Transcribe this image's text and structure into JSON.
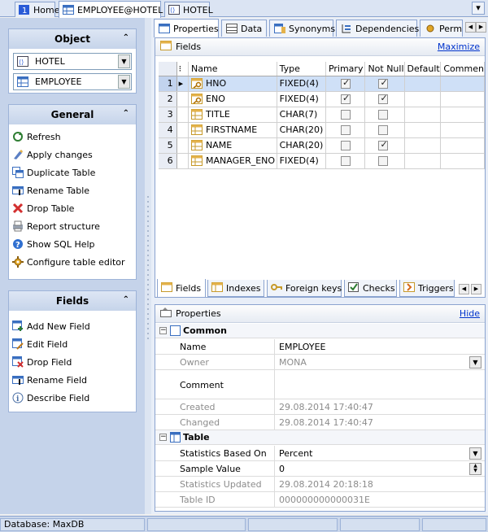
{
  "top_tabs": [
    {
      "label": "Home",
      "icon": "home-icon"
    },
    {
      "label": "EMPLOYEE@HOTEL",
      "icon": "table-icon"
    },
    {
      "label": "HOTEL",
      "icon": "database-icon"
    }
  ],
  "close_glyph": "▾",
  "left": {
    "object": {
      "title": "Object",
      "database_value": "HOTEL",
      "table_value": "EMPLOYEE"
    },
    "general": {
      "title": "General",
      "items": [
        {
          "label": "Refresh",
          "icon": "refresh-icon"
        },
        {
          "label": "Apply changes",
          "icon": "apply-icon"
        },
        {
          "label": "Duplicate Table",
          "icon": "duplicate-icon"
        },
        {
          "label": "Rename Table",
          "icon": "rename-icon"
        },
        {
          "label": "Drop Table",
          "icon": "drop-icon"
        },
        {
          "label": "Report structure",
          "icon": "report-icon"
        },
        {
          "label": "Show SQL Help",
          "icon": "help-icon"
        },
        {
          "label": "Configure table editor",
          "icon": "configure-icon"
        }
      ]
    },
    "fields": {
      "title": "Fields",
      "items": [
        {
          "label": "Add New Field",
          "icon": "add-field-icon"
        },
        {
          "label": "Edit Field",
          "icon": "edit-field-icon"
        },
        {
          "label": "Drop Field",
          "icon": "drop-field-icon"
        },
        {
          "label": "Rename Field",
          "icon": "rename-field-icon"
        },
        {
          "label": "Describe Field",
          "icon": "info-icon"
        }
      ]
    }
  },
  "right_tabs": [
    "Properties",
    "Data",
    "Synonyms",
    "Dependencies",
    "Permis"
  ],
  "fields_panel": {
    "title": "Fields",
    "maximize_label": "Maximize",
    "columns": [
      "Name",
      "Type",
      "Primary",
      "Not Null",
      "Default",
      "Commen"
    ],
    "rows": [
      {
        "num": "1",
        "name": "HNO",
        "type": "FIXED(4)",
        "primary": true,
        "not_null": true,
        "key": true
      },
      {
        "num": "2",
        "name": "ENO",
        "type": "FIXED(4)",
        "primary": true,
        "not_null": true,
        "key": true
      },
      {
        "num": "3",
        "name": "TITLE",
        "type": "CHAR(7)",
        "primary": false,
        "not_null": false,
        "key": false
      },
      {
        "num": "4",
        "name": "FIRSTNAME",
        "type": "CHAR(20)",
        "primary": false,
        "not_null": false,
        "key": false
      },
      {
        "num": "5",
        "name": "NAME",
        "type": "CHAR(20)",
        "primary": false,
        "not_null": true,
        "key": false
      },
      {
        "num": "6",
        "name": "MANAGER_ENO",
        "type": "FIXED(4)",
        "primary": false,
        "not_null": false,
        "key": false
      }
    ]
  },
  "bottom_tabs": [
    "Fields",
    "Indexes",
    "Foreign keys",
    "Checks",
    "Triggers"
  ],
  "properties": {
    "title": "Properties",
    "hide_label": "Hide",
    "common": {
      "title": "Common",
      "rows": [
        {
          "key": "Name",
          "value": "EMPLOYEE",
          "grey": false
        },
        {
          "key": "Owner",
          "value": "MONA",
          "grey": true
        },
        {
          "key": "Comment",
          "value": "",
          "grey": false
        },
        {
          "key": "Created",
          "value": "29.08.2014 17:40:47",
          "grey": true
        },
        {
          "key": "Changed",
          "value": "29.08.2014 17:40:47",
          "grey": true
        }
      ]
    },
    "table": {
      "title": "Table",
      "rows": [
        {
          "key": "Statistics Based On",
          "value": "Percent",
          "grey": false
        },
        {
          "key": "Sample Value",
          "value": "0",
          "grey": false
        },
        {
          "key": "Statistics Updated",
          "value": "29.08.2014 20:18:18",
          "grey": true
        },
        {
          "key": "Table ID",
          "value": "000000000000031E",
          "grey": true
        }
      ]
    }
  },
  "status": {
    "database": "Database: MaxDB"
  }
}
